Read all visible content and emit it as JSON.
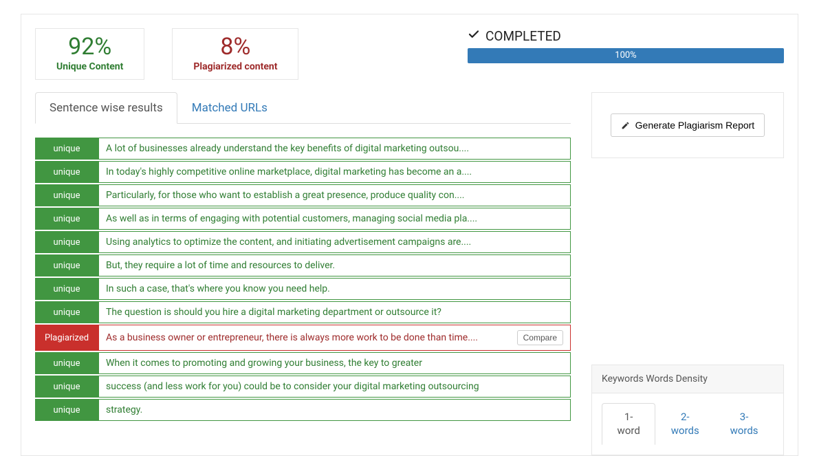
{
  "stats": {
    "unique_pct": "92%",
    "unique_label": "Unique Content",
    "plag_pct": "8%",
    "plag_label": "Plagiarized content"
  },
  "status": {
    "text": "COMPLETED",
    "progress": "100%"
  },
  "tabs": {
    "sentence": "Sentence wise results",
    "matched": "Matched URLs"
  },
  "results": [
    {
      "type": "unique",
      "text": "A lot of businesses already understand the key benefits of digital marketing outsou...."
    },
    {
      "type": "unique",
      "text": "In today's highly competitive online marketplace, digital marketing has become an a...."
    },
    {
      "type": "unique",
      "text": "Particularly, for those who want to establish a great presence, produce quality con...."
    },
    {
      "type": "unique",
      "text": "As well as in terms of engaging with potential customers, managing social media pla...."
    },
    {
      "type": "unique",
      "text": "Using analytics to optimize the content, and initiating advertisement campaigns are...."
    },
    {
      "type": "unique",
      "text": "But, they require a lot of time and resources to deliver."
    },
    {
      "type": "unique",
      "text": "In such a case, that's where you know you need help."
    },
    {
      "type": "unique",
      "text": "The question is should you hire a digital marketing department or outsource it?"
    },
    {
      "type": "plag",
      "text": "As a business owner or entrepreneur, there is always more work to be done than time...."
    },
    {
      "type": "unique",
      "text": "When it comes to promoting and growing your business, the key to greater"
    },
    {
      "type": "unique",
      "text": "success (and less work for you) could be to consider your digital marketing outsourcing"
    },
    {
      "type": "unique",
      "text": "strategy."
    }
  ],
  "badges": {
    "unique": "unique",
    "plag": "Plagiarized"
  },
  "compare_label": "Compare",
  "generate_report": "Generate Plagiarism Report",
  "density": {
    "title": "Keywords Words Density",
    "tabs": [
      "1-word",
      "2-words",
      "3-words"
    ]
  }
}
